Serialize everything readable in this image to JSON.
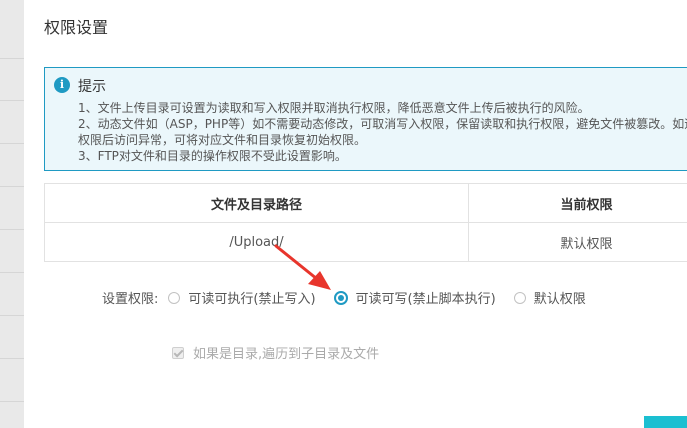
{
  "dialog": {
    "title": "权限设置"
  },
  "tip": {
    "icon": "info-icon",
    "title": "提示",
    "lines": [
      "1、文件上传目录可设置为读取和写入权限并取消执行权限，降低恶意文件上传后被执行的风险。",
      "2、动态文件如（ASP，PHP等）如不需要动态修改，可取消写入权限，保留读取和执行权限，避免文件被篡改。如遇",
      "权限后访问异常，可将对应文件和目录恢复初始权限。",
      "3、FTP对文件和目录的操作权限不受此设置影响。"
    ]
  },
  "table": {
    "headers": [
      "文件及目录路径",
      "当前权限"
    ],
    "rows": [
      {
        "path": "/Upload/",
        "permission": "默认权限"
      }
    ]
  },
  "permission": {
    "label": "设置权限:",
    "options": [
      {
        "label": "可读可执行(禁止写入)",
        "checked": false
      },
      {
        "label": "可读可写(禁止脚本执行)",
        "checked": true
      },
      {
        "label": "默认权限",
        "checked": false
      }
    ]
  },
  "recursive": {
    "label": "如果是目录,遍历到子目录及文件",
    "checked": true,
    "disabled": true
  },
  "colors": {
    "accent": "#1f9ac3",
    "arrow": "#e8352c",
    "button": "#1bbfd1"
  }
}
